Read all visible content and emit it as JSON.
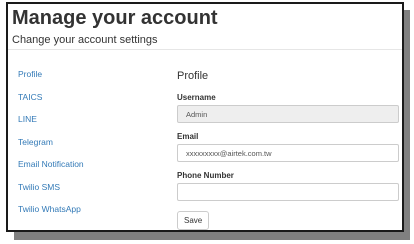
{
  "header": {
    "title": "Manage your account",
    "subtitle": "Change your account settings"
  },
  "sidebar": {
    "items": [
      {
        "label": "Profile"
      },
      {
        "label": "TAICS"
      },
      {
        "label": "LINE"
      },
      {
        "label": "Telegram"
      },
      {
        "label": "Email Notification"
      },
      {
        "label": "Twilio SMS"
      },
      {
        "label": "Twilio WhatsApp"
      }
    ]
  },
  "profile": {
    "heading": "Profile",
    "username": {
      "label": "Username",
      "value": "Admin"
    },
    "email": {
      "label": "Email",
      "value": "xxxxxxxxx@airtek.com.tw"
    },
    "phone": {
      "label": "Phone Number",
      "value": ""
    },
    "save_label": "Save"
  },
  "colors": {
    "link": "#337ab7",
    "readonly_bg": "#eeeeee",
    "border": "#cccccc"
  }
}
